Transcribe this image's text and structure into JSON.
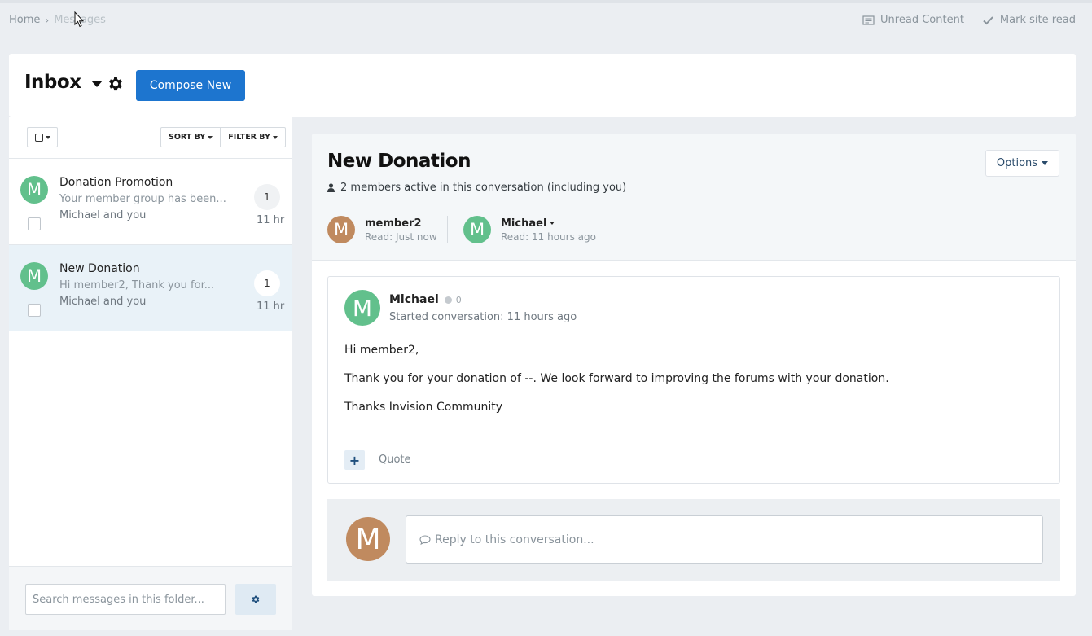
{
  "breadcrumb": {
    "home": "Home",
    "separator": "›",
    "current": "Messages"
  },
  "top_links": {
    "unread": "Unread Content",
    "mark_read": "Mark site read"
  },
  "header": {
    "title": "Inbox",
    "compose": "Compose New"
  },
  "list_toolbar": {
    "sort": "SORT BY",
    "filter": "FILTER BY"
  },
  "conversations": [
    {
      "title": "Donation Promotion",
      "snippet": "Your member group has been...",
      "participants": "Michael and you",
      "count": "1",
      "time": "11 hr",
      "avatar_letter": "M"
    },
    {
      "title": "New Donation",
      "snippet": "Hi member2, Thank you for...",
      "participants": "Michael and you",
      "count": "1",
      "time": "11 hr",
      "avatar_letter": "M"
    }
  ],
  "search": {
    "placeholder": "Search messages in this folder..."
  },
  "conversation": {
    "title": "New Donation",
    "active_members": "2 members active in this conversation (including you)",
    "options": "Options",
    "participants": [
      {
        "letter": "M",
        "name": "member2",
        "read": "Read: Just now"
      },
      {
        "letter": "M",
        "name": "Michael",
        "read": "Read: 11 hours ago"
      }
    ],
    "message": {
      "avatar_letter": "M",
      "author": "Michael",
      "reputation": "0",
      "started": "Started conversation: 11 hours ago",
      "lines": [
        "Hi member2,",
        "Thank you for your donation of --. We look forward to improving the forums with your donation.",
        "Thanks Invision Community"
      ],
      "quote": "Quote"
    },
    "reply": {
      "avatar_letter": "M",
      "placeholder": "Reply to this conversation..."
    }
  },
  "colors": {
    "accent": "#1d75cf",
    "avatar_green": "#62c08c",
    "avatar_brown": "#c08a5f",
    "page_bg": "#ebeef2"
  }
}
